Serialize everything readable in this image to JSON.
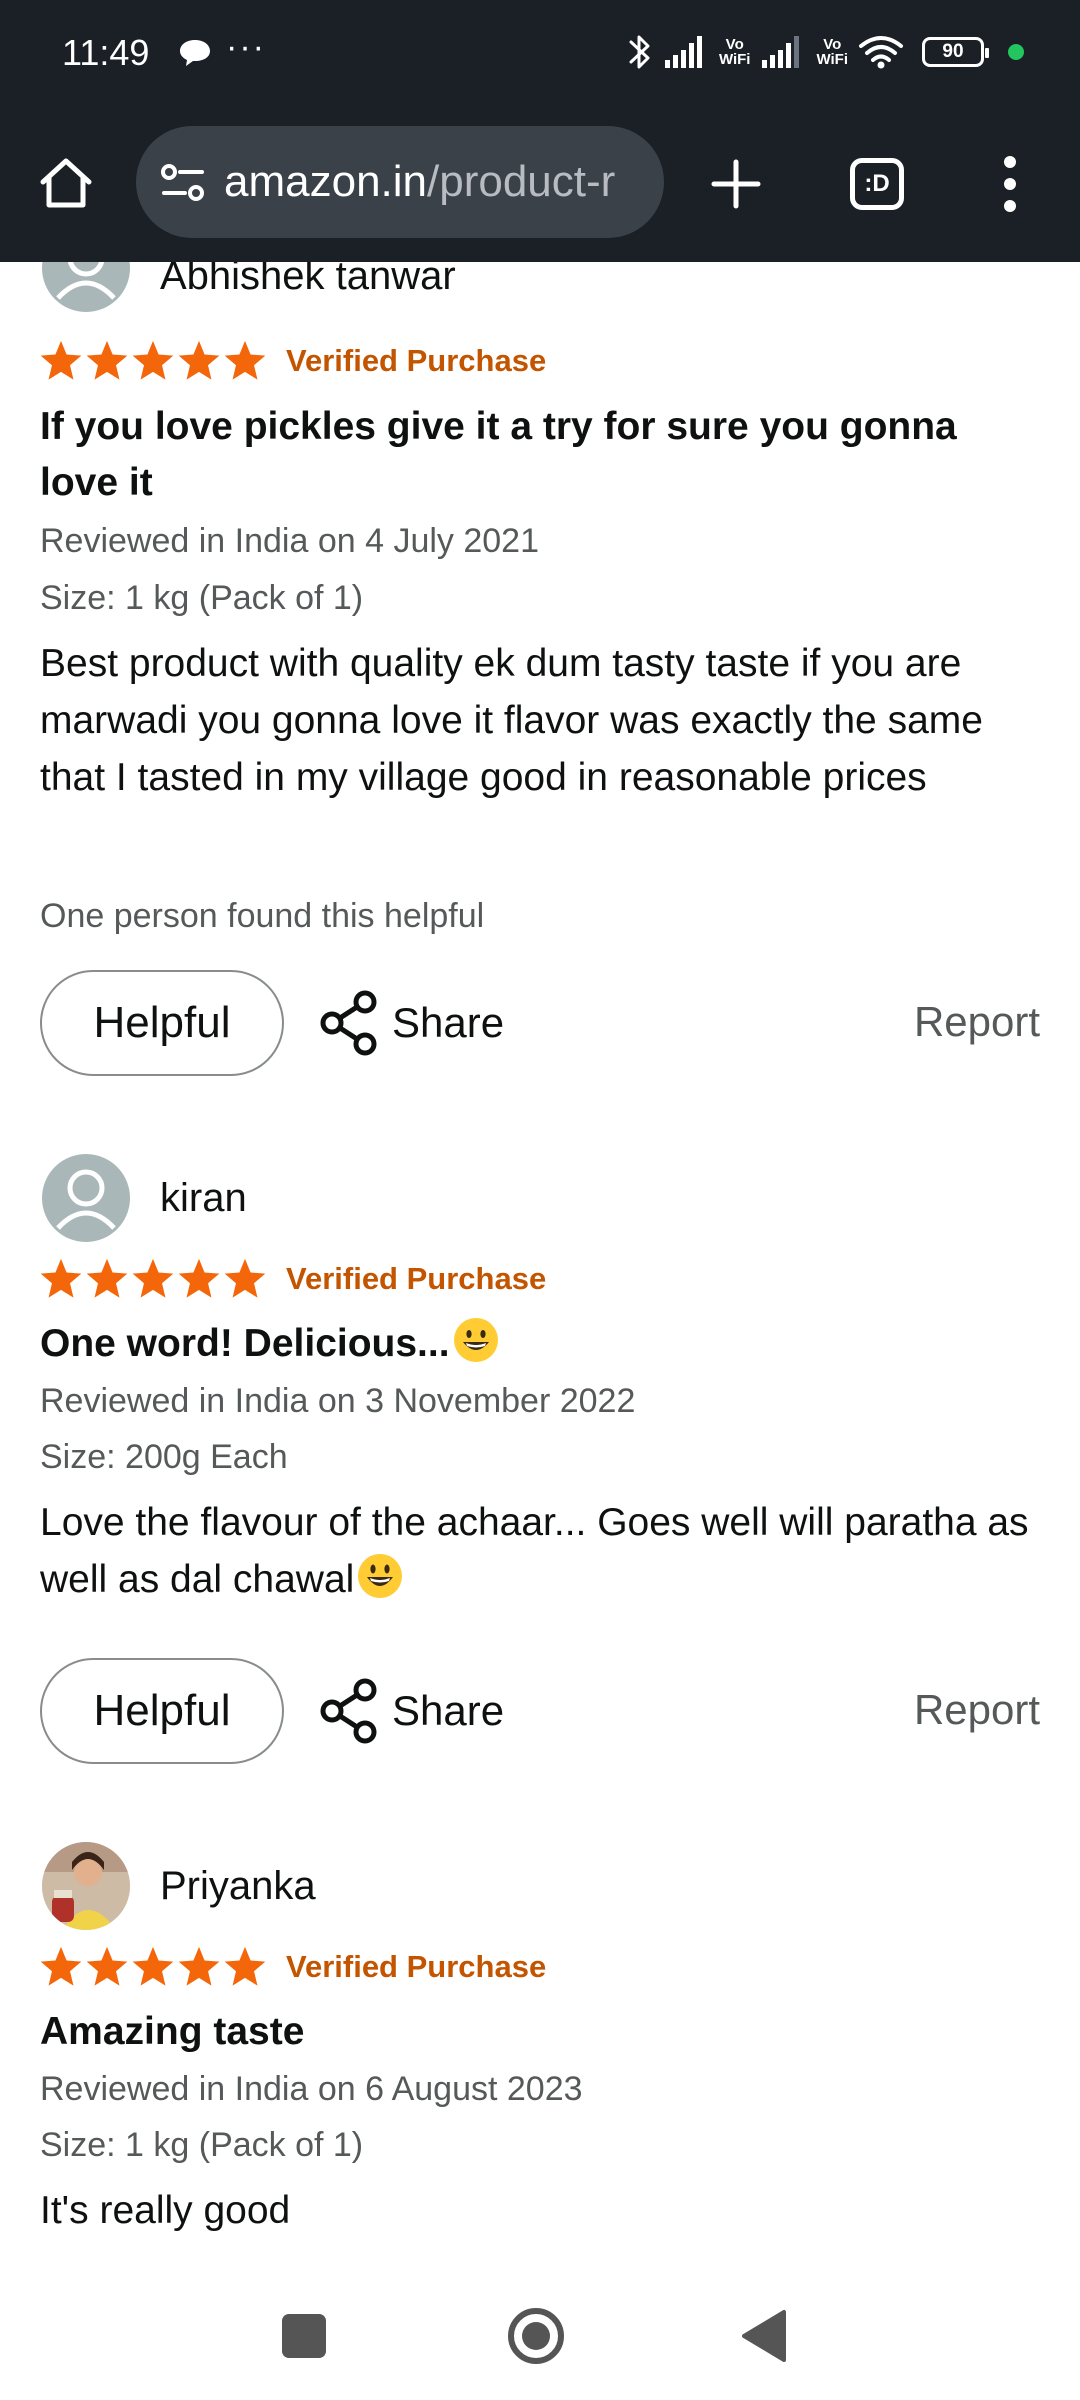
{
  "status_bar": {
    "time": "11:49",
    "overflow": "···",
    "vowifi_1": [
      "Vo",
      "WiFi"
    ],
    "vowifi_2": [
      "Vo",
      "WiFi"
    ],
    "battery": "90",
    "icons": [
      "chat-bubble-icon",
      "bluetooth-icon",
      "signal-icon",
      "signal-icon",
      "wifi-icon",
      "battery-icon"
    ]
  },
  "browser": {
    "url_host": "amazon.in",
    "url_path": "/product-r",
    "tab_switcher_label": ":D"
  },
  "reviews": [
    {
      "name": "Abhishek tanwar",
      "rating": 5,
      "verified": "Verified Purchase",
      "title": "If you love pickles give it a try for sure you gonna love it",
      "date": "Reviewed in India on 4 July 2021",
      "size": "Size: 1 kg (Pack of 1)",
      "body": "Best product with quality ek dum tasty taste if you are marwadi you gonna love it flavor was exactly the same that I tasted in my village good in reasonable prices",
      "helpful_count_text": "One person found this helpful",
      "helpful_label": "Helpful",
      "share_label": "Share",
      "report_label": "Report"
    },
    {
      "name": "kiran",
      "rating": 5,
      "verified": "Verified Purchase",
      "title": "One word! Delicious...",
      "date": "Reviewed in India on 3 November 2022",
      "size": "Size: 200g Each",
      "body": "Love the flavour of the achaar... Goes well will paratha as well as dal chawal",
      "helpful_label": "Helpful",
      "share_label": "Share",
      "report_label": "Report"
    },
    {
      "name": "Priyanka",
      "rating": 5,
      "verified": "Verified Purchase",
      "title": "Amazing taste",
      "date": "Reviewed in India on 6 August 2023",
      "size": "Size: 1 kg (Pack of 1)",
      "body": "It's really good"
    }
  ],
  "colors": {
    "star": "#f4660a",
    "verified": "#c45500",
    "chrome_bg": "#1b2027",
    "url_bg": "#3b4149",
    "meta_text": "#565959"
  }
}
